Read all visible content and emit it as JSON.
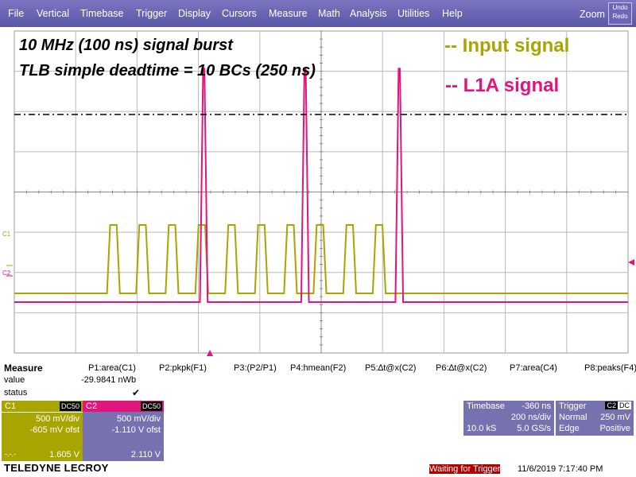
{
  "menu": {
    "items": [
      "File",
      "Vertical",
      "Timebase",
      "Trigger",
      "Display",
      "Cursors",
      "Measure",
      "Math",
      "Analysis",
      "Utilities",
      "Help"
    ],
    "zoom": "Zoom",
    "undo": [
      "Undo",
      "Redo"
    ]
  },
  "annotations": {
    "line1": "10 MHz (100 ns) signal burst",
    "line2": "TLB simple deadtime = 10 BCs (250 ns)",
    "legend_input": "-- Input signal",
    "legend_l1a": "-- L1A signal"
  },
  "channel_markers": {
    "c1": "C1",
    "c2": "C2"
  },
  "colors": {
    "c1": "#a8a400",
    "c2": "#e2157c",
    "panel": "#7672b0",
    "menubar": "#5a56a8"
  },
  "measure": {
    "title": "Measure",
    "row_labels": [
      "value",
      "status"
    ],
    "params": [
      "P1:area(C1)",
      "P2:pkpk(F1)",
      "P3:(P2/P1)",
      "P4:hmean(F2)",
      "P5:∆t@x(C2)",
      "P6:∆t@x(C2)",
      "P7:area(C4)",
      "P8:peaks(F4)"
    ],
    "p1_value": "-29.9841 nWb",
    "p1_status": "✔"
  },
  "channels": [
    {
      "id": "C1",
      "coupling": "DC50",
      "scale": "500 mV/div",
      "offset": "-605 mV ofst",
      "dashes": "-.-.-",
      "level": "1.605 V"
    },
    {
      "id": "C2",
      "coupling": "DC50",
      "scale": "500 mV/div",
      "offset": "-1.110 V ofst",
      "level": "2.110 V"
    }
  ],
  "timebase": {
    "label": "Timebase",
    "delay": "-360 ns",
    "per_div": "200 ns/div",
    "samples": "10.0 kS",
    "rate": "5.0 GS/s"
  },
  "trigger": {
    "label": "Trigger",
    "source": "C2",
    "coupling": "DC",
    "mode": "Normal",
    "level": "250 mV",
    "type": "Edge",
    "slope": "Positive"
  },
  "footer": {
    "brand": "TELEDYNE LECROY",
    "status": "Waiting for Trigger",
    "timestamp": "11/6/2019 7:17:40 PM"
  },
  "chart_data": {
    "type": "line",
    "xlabel": "",
    "ylabel": "",
    "grid": true,
    "x_divisions": 10,
    "y_divisions": 8,
    "xlim": [
      -2.16,
      -0.16
    ],
    "x_unit": "µs",
    "series": [
      {
        "name": "Input signal",
        "channel": "C1",
        "baseline_div": 0.0,
        "high_div": 1.7,
        "pulse_start_div": [
          3.02,
          3.97,
          4.93,
          5.9,
          6.87,
          7.84,
          8.79,
          9.75,
          10.72,
          11.68
        ],
        "pulse_width_div": 0.42
      },
      {
        "name": "L1A signal",
        "channel": "C2",
        "baseline_div": 0.0,
        "high_div": 5.8,
        "pulse_start_div": [
          6.05,
          9.35,
          12.42
        ],
        "pulse_width_div": 0.25
      }
    ],
    "trigger_level_div": 5.4
  }
}
